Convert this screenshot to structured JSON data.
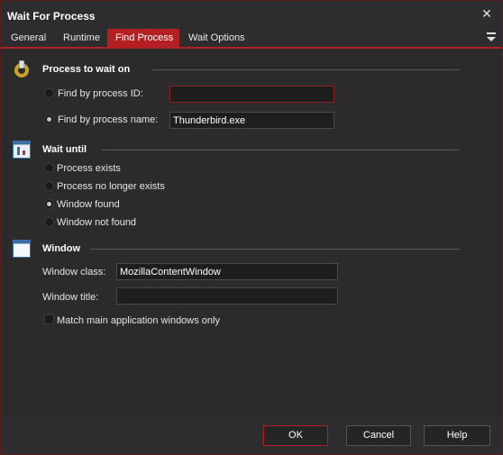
{
  "window": {
    "title": "Wait For Process"
  },
  "tabs": [
    {
      "label": "General",
      "active": false
    },
    {
      "label": "Runtime",
      "active": false
    },
    {
      "label": "Find Process",
      "active": true
    },
    {
      "label": "Wait Options",
      "active": false
    }
  ],
  "process_section": {
    "title": "Process to wait on",
    "icon": "process-icon",
    "by_id_label": "Find by process ID:",
    "by_id_value": "",
    "by_name_label": "Find by process name:",
    "by_name_value": "Thunderbird.exe",
    "selected": "by_name"
  },
  "wait_section": {
    "title": "Wait until",
    "icon": "wait-icon",
    "options": [
      {
        "label": "Process exists",
        "checked": false
      },
      {
        "label": "Process no longer exists",
        "checked": false
      },
      {
        "label": "Window found",
        "checked": true
      },
      {
        "label": "Window not found",
        "checked": false
      }
    ]
  },
  "window_section": {
    "title": "Window",
    "icon": "window-icon",
    "class_label": "Window class:",
    "class_value": "MozillaContentWindow",
    "title_label": "Window title:",
    "title_value": "",
    "match_main_label": "Match main application windows only",
    "match_main_checked": false
  },
  "footer": {
    "ok_label": "OK",
    "cancel_label": "Cancel",
    "help_label": "Help"
  },
  "colors": {
    "accent": "#b41f24",
    "background": "#2b2b2b",
    "input_bg": "#1e1e1e"
  }
}
